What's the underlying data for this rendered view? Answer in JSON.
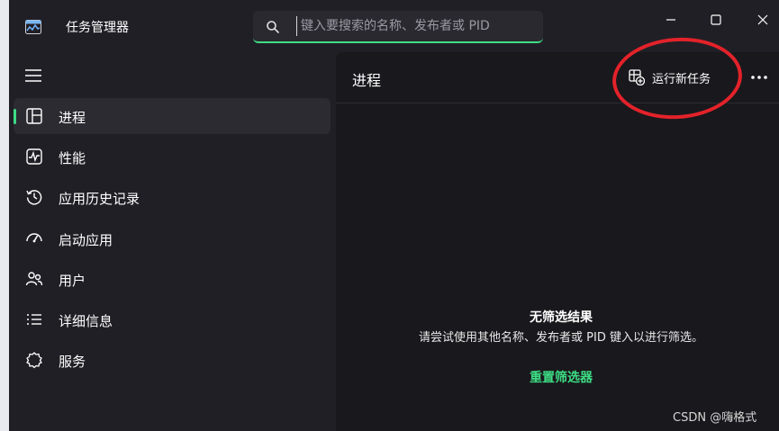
{
  "app": {
    "title": "任务管理器",
    "icon": "task-manager-icon"
  },
  "search": {
    "placeholder": "键入要搜索的名称、发布者或 PID",
    "value": ""
  },
  "window_controls": {
    "minimize": "minimize-icon",
    "maximize": "maximize-icon",
    "close": "close-icon"
  },
  "sidebar": {
    "menu_icon": "hamburger-icon",
    "items": [
      {
        "label": "进程",
        "icon": "processes-icon",
        "active": true
      },
      {
        "label": "性能",
        "icon": "performance-icon",
        "active": false
      },
      {
        "label": "应用历史记录",
        "icon": "history-icon",
        "active": false
      },
      {
        "label": "启动应用",
        "icon": "startup-icon",
        "active": false
      },
      {
        "label": "用户",
        "icon": "users-icon",
        "active": false
      },
      {
        "label": "详细信息",
        "icon": "details-icon",
        "active": false
      },
      {
        "label": "服务",
        "icon": "services-icon",
        "active": false
      }
    ]
  },
  "main": {
    "title": "进程",
    "run_new_task": "运行新任务",
    "more_icon": "more-icon",
    "empty_title": "无筛选结果",
    "empty_description": "请尝试使用其他名称、发布者或 PID 键入以进行筛选。",
    "reset_filter": "重置筛选器"
  },
  "watermark": "CSDN @嗨格式",
  "colors": {
    "accent": "#3ddc84",
    "annotation": "#e3222a",
    "sidebar_bg": "#211f26",
    "main_bg": "#19181c"
  }
}
